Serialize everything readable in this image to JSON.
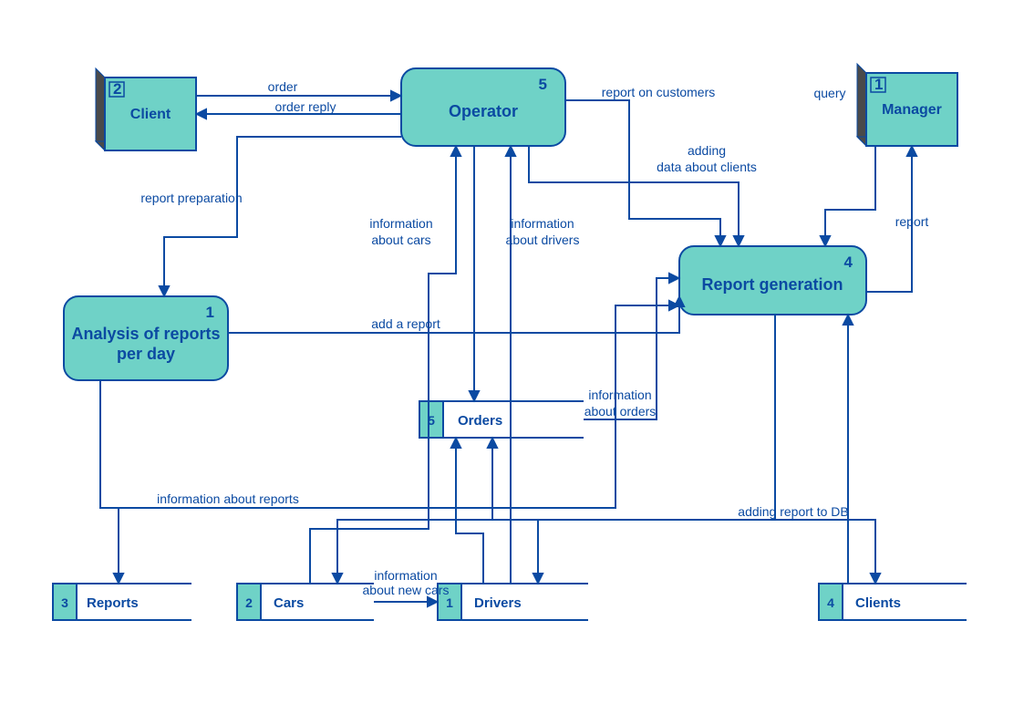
{
  "entities": {
    "client": {
      "label": "Client",
      "number": "2"
    },
    "manager": {
      "label": "Manager",
      "number": "1"
    }
  },
  "processes": {
    "operator": {
      "label": "Operator",
      "number": "5"
    },
    "reportGen": {
      "label": "Report generation",
      "number": "4"
    },
    "analysis": {
      "label": [
        "Analysis of reports",
        "per day"
      ],
      "number": "1"
    }
  },
  "stores": {
    "orders": {
      "label": "Orders",
      "number": "5"
    },
    "reports": {
      "label": "Reports",
      "number": "3"
    },
    "cars": {
      "label": "Cars",
      "number": "2"
    },
    "drivers": {
      "label": "Drivers",
      "number": "1"
    },
    "clients": {
      "label": "Clients",
      "number": "4"
    }
  },
  "flows": {
    "order": "order",
    "orderReply": "order reply",
    "reportOnCustomers": "report on customers",
    "addingDataAboutClients": [
      "adding",
      "data about clients"
    ],
    "query": "query",
    "report": "report",
    "reportPreparation": "report preparation",
    "infoCars": [
      "information",
      "about cars"
    ],
    "infoDrivers": [
      "information",
      "about drivers"
    ],
    "addReport": "add a report",
    "infoOrders": [
      "information",
      "about orders"
    ],
    "infoReports": "information about reports",
    "addingReportToDB": "adding report to DB",
    "infoNewCars": [
      "information",
      "about new cars"
    ]
  }
}
